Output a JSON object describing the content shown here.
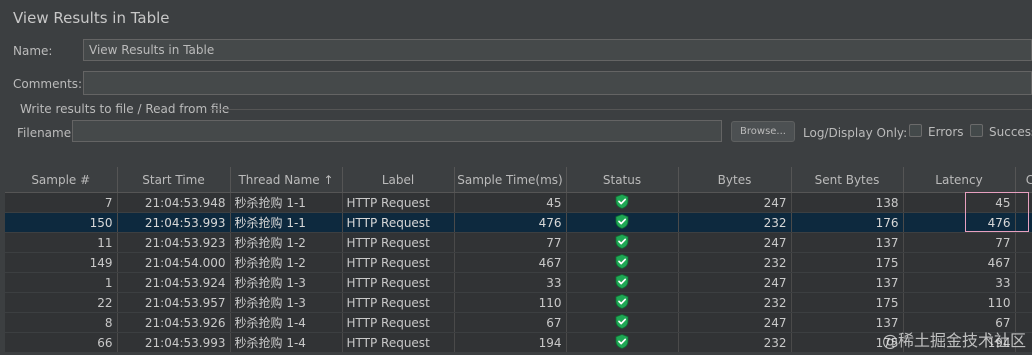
{
  "window_title": "View Results in Table",
  "name": {
    "label": "Name:",
    "value": "View Results in Table"
  },
  "comments": {
    "label": "Comments:",
    "value": ""
  },
  "write_group": {
    "title": "Write results to file / Read from file"
  },
  "filename": {
    "label": "Filename",
    "value": ""
  },
  "browse_label": "Browse...",
  "log_display": {
    "label": "Log/Display Only:",
    "errors_label": "Errors",
    "successes_label": "Successes"
  },
  "table": {
    "columns": [
      "Sample #",
      "Start Time",
      "Thread Name ↑",
      "Label",
      "Sample Time(ms)",
      "Status",
      "Bytes",
      "Sent Bytes",
      "Latency",
      "C"
    ],
    "rows": [
      {
        "sample": "7",
        "start": "21:04:53.948",
        "thread": "秒杀抢购 1-1",
        "label": "HTTP Request",
        "time": "45",
        "bytes": "247",
        "sent": "138",
        "latency": "45"
      },
      {
        "sample": "150",
        "start": "21:04:53.993",
        "thread": "秒杀抢购 1-1",
        "label": "HTTP Request",
        "time": "476",
        "bytes": "232",
        "sent": "176",
        "latency": "476"
      },
      {
        "sample": "11",
        "start": "21:04:53.923",
        "thread": "秒杀抢购 1-2",
        "label": "HTTP Request",
        "time": "77",
        "bytes": "247",
        "sent": "137",
        "latency": "77"
      },
      {
        "sample": "149",
        "start": "21:04:54.000",
        "thread": "秒杀抢购 1-2",
        "label": "HTTP Request",
        "time": "467",
        "bytes": "232",
        "sent": "175",
        "latency": "467"
      },
      {
        "sample": "1",
        "start": "21:04:53.924",
        "thread": "秒杀抢购 1-3",
        "label": "HTTP Request",
        "time": "33",
        "bytes": "247",
        "sent": "137",
        "latency": "33"
      },
      {
        "sample": "22",
        "start": "21:04:53.957",
        "thread": "秒杀抢购 1-3",
        "label": "HTTP Request",
        "time": "110",
        "bytes": "232",
        "sent": "175",
        "latency": "110"
      },
      {
        "sample": "8",
        "start": "21:04:53.926",
        "thread": "秒杀抢购 1-4",
        "label": "HTTP Request",
        "time": "67",
        "bytes": "247",
        "sent": "137",
        "latency": "67"
      },
      {
        "sample": "66",
        "start": "21:04:53.993",
        "thread": "秒杀抢购 1-4",
        "label": "HTTP Request",
        "time": "194",
        "bytes": "232",
        "sent": "175",
        "latency": "194"
      }
    ],
    "selected_row": 1
  },
  "status_icon": "green-shield-check-icon",
  "colors": {
    "selected_row": "#0d293e",
    "status_ok": "#1fa855",
    "highlight_box": "#e7a0c0"
  },
  "watermark": "@稀土掘金技术社区"
}
